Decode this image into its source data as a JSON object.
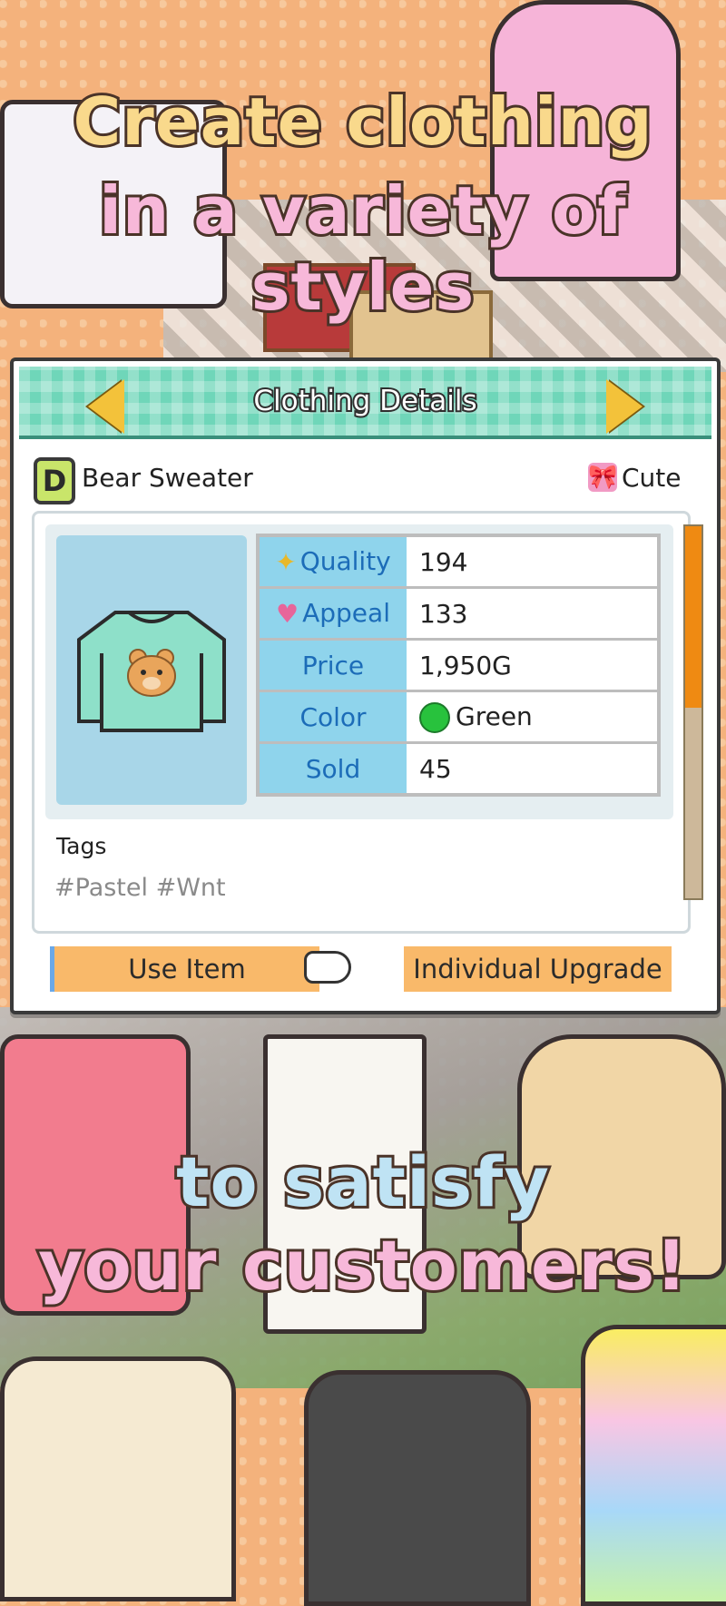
{
  "headline": {
    "line1": "Create clothing",
    "line2": "in a variety of styles",
    "line3": "to satisfy",
    "line4": "your customers!"
  },
  "panel": {
    "title": "Clothing Details",
    "rank": "D",
    "item_name": "Bear Sweater",
    "style_label": "Cute",
    "stats": [
      {
        "label": "Quality",
        "value": "194",
        "icon": "sparkle-icon"
      },
      {
        "label": "Appeal",
        "value": "133",
        "icon": "heart-icon"
      },
      {
        "label": "Price",
        "value": "1,950G",
        "icon": ""
      },
      {
        "label": "Color",
        "value": "Green",
        "icon": "green-dot-icon"
      },
      {
        "label": "Sold",
        "value": "45",
        "icon": ""
      }
    ],
    "tags_title": "Tags",
    "tags_value": "#Pastel #Wnt",
    "use_item_label": "Use Item",
    "upgrade_label": "Individual Upgrade"
  },
  "colors": {
    "header": "#6fd6b9",
    "label_cell": "#8fd4ec",
    "button": "#f9b96a",
    "scroll_thumb": "#ef8a12",
    "background": "#f4b27c"
  }
}
